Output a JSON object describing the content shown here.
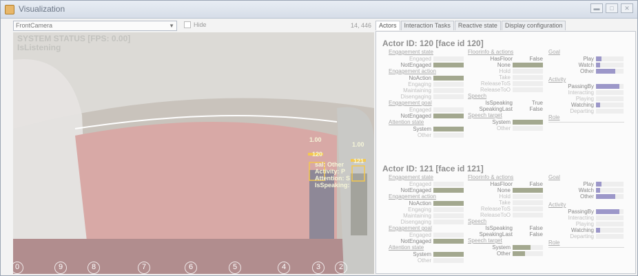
{
  "window": {
    "title": "Visualization",
    "buttons": [
      "minimize",
      "maximize",
      "close"
    ]
  },
  "toolbar": {
    "camera_select": "FrontCamera",
    "hide_label": "Hide",
    "coords": "14, 446"
  },
  "camera": {
    "status_line1": "SYSTEM STATUS [FPS: 0.00]",
    "status_line2": "IsListening",
    "score_labels": [
      "1.00",
      "1.00"
    ],
    "id_labels": [
      "120",
      "121"
    ],
    "overlay_lines": [
      "sal: Other",
      "Activity: P",
      "Attention: S",
      "IsSpeaking:"
    ],
    "seat_numbers": [
      "0",
      "9",
      "8",
      "7",
      "6",
      "5",
      "4",
      "3",
      "2"
    ]
  },
  "tabs": [
    "Actors",
    "Interaction Tasks",
    "Reactive state",
    "Display configuration"
  ],
  "colors": {
    "green": "#a3a88f",
    "purple": "#9c97c9",
    "grey": "#c7c7c7"
  },
  "actors": [
    {
      "title": "Actor ID: 120 [face id 120]",
      "engagement_state": {
        "label": "Engagement state",
        "items": [
          {
            "name": "Engaged",
            "level": 0
          },
          {
            "name": "NotEngaged",
            "level": 1
          }
        ]
      },
      "engagement_action": {
        "label": "Engagement action",
        "items": [
          {
            "name": "NoAction",
            "level": 1
          },
          {
            "name": "Engaging",
            "level": 0
          },
          {
            "name": "Maintaining",
            "level": 0
          },
          {
            "name": "Disengaging",
            "level": 0
          }
        ]
      },
      "engagement_goal": {
        "label": "Engagement goal",
        "items": [
          {
            "name": "Engaged",
            "level": 0
          },
          {
            "name": "NotEngaged",
            "level": 1
          }
        ]
      },
      "attention_state": {
        "label": "Attention state",
        "items": [
          {
            "name": "System",
            "level": 1
          },
          {
            "name": "Other",
            "level": 0
          }
        ]
      },
      "floorinfo": {
        "label": "Floorinfo & actions",
        "hasfloor_label": "HasFloor",
        "hasfloor_value": "False",
        "items": [
          {
            "name": "None",
            "level": 1
          },
          {
            "name": "Hold",
            "level": 0
          },
          {
            "name": "Take",
            "level": 0
          },
          {
            "name": "ReleaseToS",
            "level": 0
          },
          {
            "name": "ReleaseToO",
            "level": 0
          }
        ]
      },
      "speech": {
        "label": "Speech",
        "rows": [
          {
            "name": "IsSpeaking",
            "value": "True"
          },
          {
            "name": "SpeakingLast",
            "value": "False"
          }
        ]
      },
      "speech_target": {
        "label": "Speech target",
        "items": [
          {
            "name": "System",
            "level": 1
          },
          {
            "name": "Other",
            "level": 0
          }
        ]
      },
      "goal": {
        "label": "Goal",
        "items": [
          {
            "name": "Play",
            "level": 0.2
          },
          {
            "name": "Watch",
            "level": 0.15
          },
          {
            "name": "Other",
            "level": 0.7
          }
        ]
      },
      "activity": {
        "label": "Activity",
        "items": [
          {
            "name": "PassingBy",
            "level": 0.85
          },
          {
            "name": "Interacting",
            "level": 0
          },
          {
            "name": "Playing",
            "level": 0
          },
          {
            "name": "Watching",
            "level": 0.15
          },
          {
            "name": "Departing",
            "level": 0
          }
        ]
      },
      "role": {
        "label": "Role"
      }
    },
    {
      "title": "Actor ID: 121 [face id 121]",
      "engagement_state": {
        "label": "Engagement state",
        "items": [
          {
            "name": "Engaged",
            "level": 0
          },
          {
            "name": "NotEngaged",
            "level": 1
          }
        ]
      },
      "engagement_action": {
        "label": "Engagement action",
        "items": [
          {
            "name": "NoAction",
            "level": 1
          },
          {
            "name": "Engaging",
            "level": 0
          },
          {
            "name": "Maintaining",
            "level": 0
          },
          {
            "name": "Disengaging",
            "level": 0
          }
        ]
      },
      "engagement_goal": {
        "label": "Engagement goal",
        "items": [
          {
            "name": "Engaged",
            "level": 0
          },
          {
            "name": "NotEngaged",
            "level": 1
          }
        ]
      },
      "attention_state": {
        "label": "Attention state",
        "items": [
          {
            "name": "System",
            "level": 1
          },
          {
            "name": "Other",
            "level": 0
          }
        ]
      },
      "floorinfo": {
        "label": "Floorinfo & actions",
        "hasfloor_label": "HasFloor",
        "hasfloor_value": "False",
        "items": [
          {
            "name": "None",
            "level": 1
          },
          {
            "name": "Hold",
            "level": 0
          },
          {
            "name": "Take",
            "level": 0
          },
          {
            "name": "ReleaseToS",
            "level": 0
          },
          {
            "name": "ReleaseToO",
            "level": 0
          }
        ]
      },
      "speech": {
        "label": "Speech",
        "rows": [
          {
            "name": "IsSpeaking",
            "value": "False"
          },
          {
            "name": "SpeakingLast",
            "value": "False"
          }
        ]
      },
      "speech_target": {
        "label": "Speech target",
        "items": [
          {
            "name": "System",
            "level": 0.6
          },
          {
            "name": "Other",
            "level": 0.4
          }
        ]
      },
      "goal": {
        "label": "Goal",
        "items": [
          {
            "name": "Play",
            "level": 0.2
          },
          {
            "name": "Watch",
            "level": 0.15
          },
          {
            "name": "Other",
            "level": 0.7
          }
        ]
      },
      "activity": {
        "label": "Activity",
        "items": [
          {
            "name": "PassingBy",
            "level": 0.85
          },
          {
            "name": "Interacting",
            "level": 0
          },
          {
            "name": "Playing",
            "level": 0
          },
          {
            "name": "Watching",
            "level": 0.15
          },
          {
            "name": "Departing",
            "level": 0
          }
        ]
      },
      "role": {
        "label": "Role"
      }
    }
  ]
}
